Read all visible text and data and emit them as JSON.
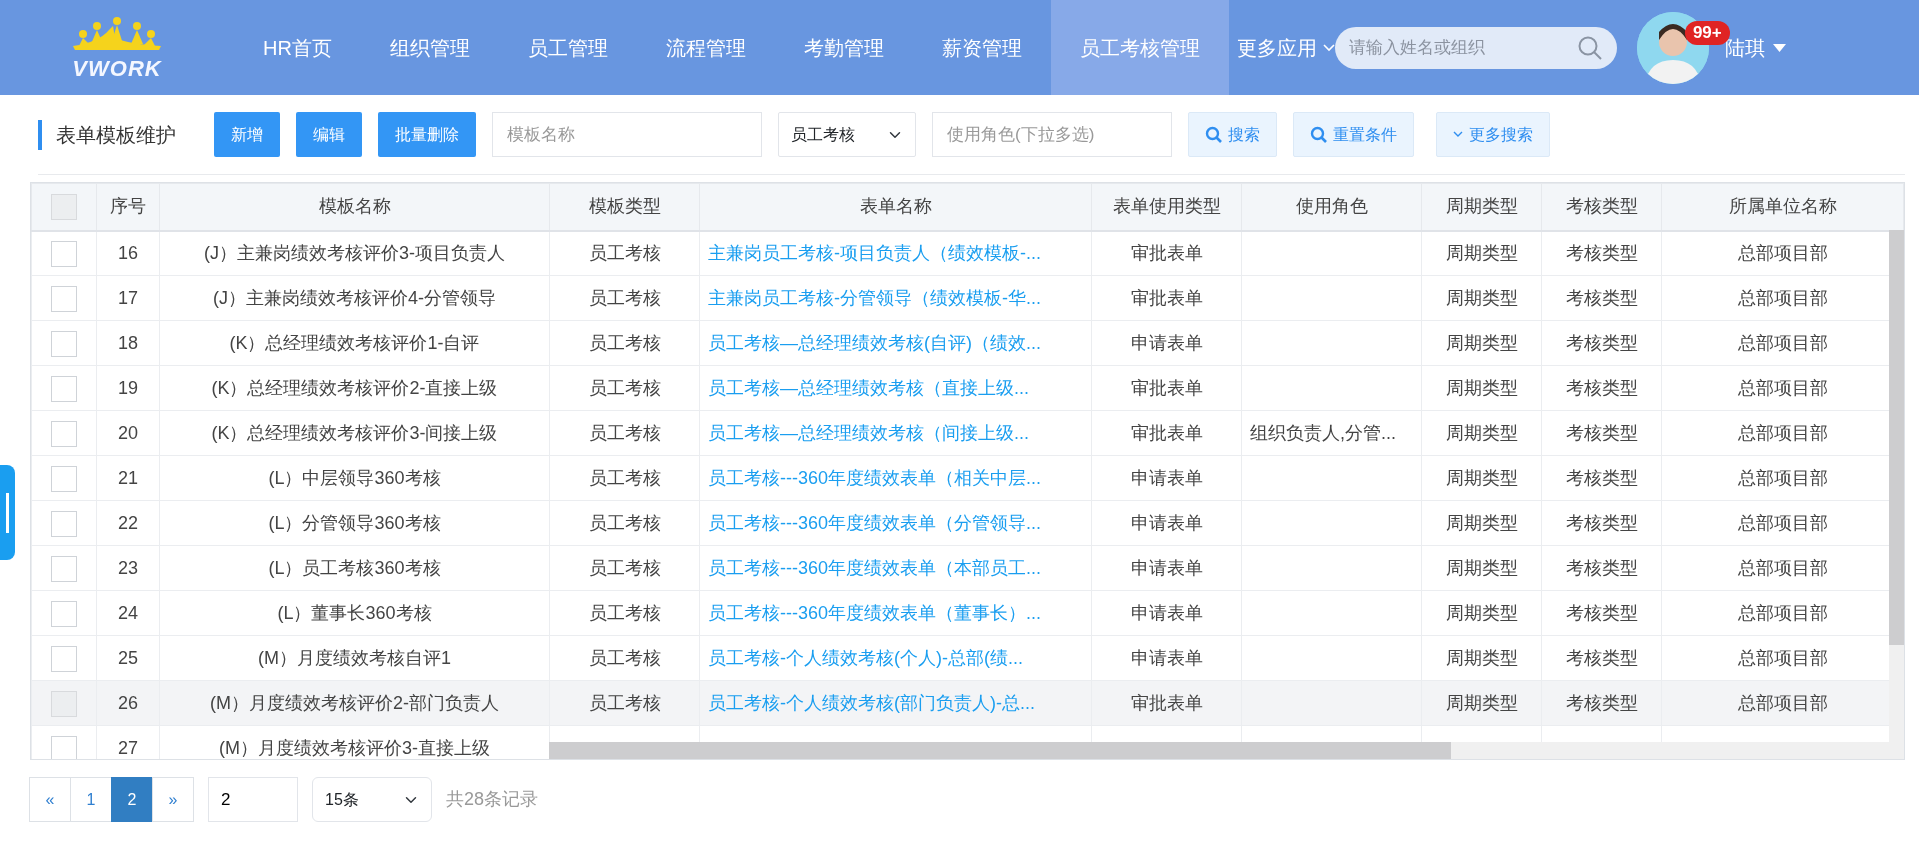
{
  "header": {
    "logo_text": "VWORK",
    "nav": [
      {
        "label": "HR首页",
        "selected": false
      },
      {
        "label": "组织管理",
        "selected": false
      },
      {
        "label": "员工管理",
        "selected": false
      },
      {
        "label": "流程管理",
        "selected": false
      },
      {
        "label": "考勤管理",
        "selected": false
      },
      {
        "label": "薪资管理",
        "selected": false
      },
      {
        "label": "员工考核管理",
        "selected": true
      }
    ],
    "more_apps": "更多应用",
    "search": {
      "placeholder": "请输入姓名或组织"
    },
    "user": {
      "name": "陆琪",
      "badge": "99+"
    }
  },
  "toolbar": {
    "title": "表单模板维护",
    "buttons": [
      "新增",
      "编辑",
      "批量删除"
    ],
    "name_filter": {
      "placeholder": "模板名称"
    },
    "type_select": {
      "value": "员工考核"
    },
    "role_filter": {
      "placeholder": "使用角色(下拉多选)"
    },
    "search_buttons": [
      {
        "kind": "search",
        "label": "搜索"
      },
      {
        "kind": "search",
        "label": "重置条件"
      },
      {
        "kind": "expand",
        "label": "更多搜索"
      }
    ]
  },
  "table": {
    "select_all": {
      "checked": false
    },
    "columns": [
      "序号",
      "模板名称",
      "模板类型",
      "表单名称",
      "表单使用类型",
      "使用角色",
      "周期类型",
      "考核类型",
      "所属单位名称"
    ],
    "rows": [
      {
        "checked": false,
        "highlighted": false,
        "cells": [
          "16",
          "(J）主兼岗绩效考核评价3-项目负责人",
          "员工考核",
          "主兼岗员工考核-项目负责人（绩效模板-...",
          "审批表单",
          "",
          "周期类型",
          "考核类型",
          "总部项目部"
        ]
      },
      {
        "checked": false,
        "highlighted": false,
        "cells": [
          "17",
          "(J）主兼岗绩效考核评价4-分管领导",
          "员工考核",
          "主兼岗员工考核-分管领导（绩效模板-华...",
          "审批表单",
          "",
          "周期类型",
          "考核类型",
          "总部项目部"
        ]
      },
      {
        "checked": false,
        "highlighted": false,
        "cells": [
          "18",
          "(K）总经理绩效考核评价1-自评",
          "员工考核",
          "员工考核—总经理绩效考核(自评)（绩效...",
          "申请表单",
          "",
          "周期类型",
          "考核类型",
          "总部项目部"
        ]
      },
      {
        "checked": false,
        "highlighted": false,
        "cells": [
          "19",
          "(K）总经理绩效考核评价2-直接上级",
          "员工考核",
          "员工考核—总经理绩效考核（直接上级...",
          "审批表单",
          "",
          "周期类型",
          "考核类型",
          "总部项目部"
        ]
      },
      {
        "checked": false,
        "highlighted": false,
        "cells": [
          "20",
          "(K）总经理绩效考核评价3-间接上级",
          "员工考核",
          "员工考核—总经理绩效考核（间接上级...",
          "审批表单",
          "组织负责人,分管...",
          "周期类型",
          "考核类型",
          "总部项目部"
        ]
      },
      {
        "checked": false,
        "highlighted": false,
        "cells": [
          "21",
          "(L）中层领导360考核",
          "员工考核",
          "员工考核---360年度绩效表单（相关中层...",
          "申请表单",
          "",
          "周期类型",
          "考核类型",
          "总部项目部"
        ]
      },
      {
        "checked": false,
        "highlighted": false,
        "cells": [
          "22",
          "(L）分管领导360考核",
          "员工考核",
          "员工考核---360年度绩效表单（分管领导...",
          "申请表单",
          "",
          "周期类型",
          "考核类型",
          "总部项目部"
        ]
      },
      {
        "checked": false,
        "highlighted": false,
        "cells": [
          "23",
          "(L）员工考核360考核",
          "员工考核",
          "员工考核---360年度绩效表单（本部员工...",
          "申请表单",
          "",
          "周期类型",
          "考核类型",
          "总部项目部"
        ]
      },
      {
        "checked": false,
        "highlighted": false,
        "cells": [
          "24",
          "(L）董事长360考核",
          "员工考核",
          "员工考核---360年度绩效表单（董事长）...",
          "申请表单",
          "",
          "周期类型",
          "考核类型",
          "总部项目部"
        ]
      },
      {
        "checked": false,
        "highlighted": false,
        "cells": [
          "25",
          "(M）月度绩效考核自评1",
          "员工考核",
          "员工考核-个人绩效考核(个人)-总部(绩...",
          "申请表单",
          "",
          "周期类型",
          "考核类型",
          "总部项目部"
        ]
      },
      {
        "checked": false,
        "highlighted": true,
        "cells": [
          "26",
          "(M）月度绩效考核评价2-部门负责人",
          "员工考核",
          "员工考核-个人绩效考核(部门负责人)-总...",
          "审批表单",
          "",
          "周期类型",
          "考核类型",
          "总部项目部"
        ]
      },
      {
        "checked": false,
        "highlighted": false,
        "cells": [
          "27",
          "(M）月度绩效考核评价3-直接上级"
        ]
      }
    ]
  },
  "pagination": {
    "pages": [
      {
        "label": "«",
        "selected": false
      },
      {
        "label": "1",
        "selected": false
      },
      {
        "label": "2",
        "selected": true
      },
      {
        "label": "»",
        "selected": false
      }
    ],
    "jump_value": "2",
    "page_size": "15条",
    "total": "共28条记录"
  }
}
